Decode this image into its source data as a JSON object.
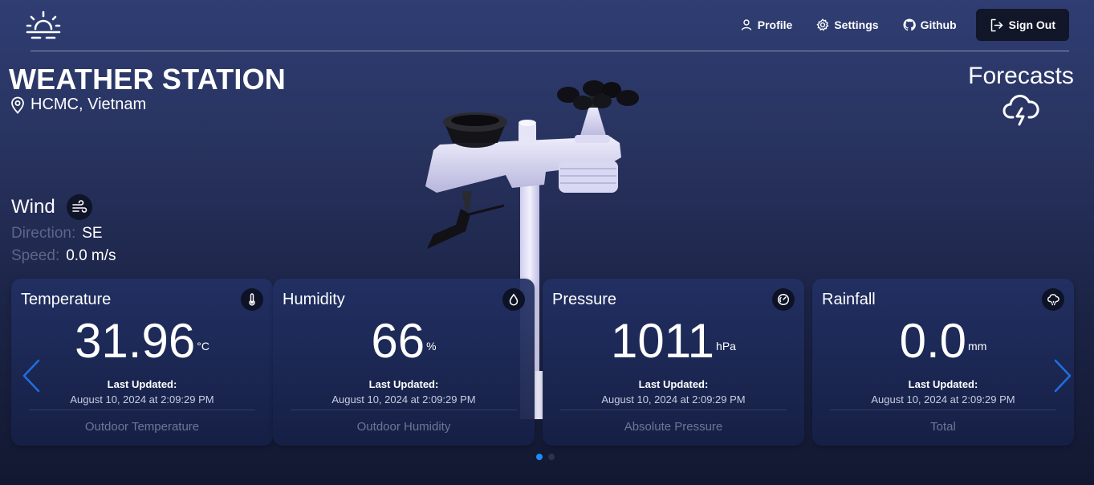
{
  "header": {
    "logo_icon": "sunrise-icon",
    "nav": [
      {
        "label": "Profile",
        "icon": "user-icon"
      },
      {
        "label": "Settings",
        "icon": "gear-icon"
      },
      {
        "label": "Github",
        "icon": "github-icon"
      }
    ],
    "sign_out": {
      "label": "Sign Out",
      "icon": "sign-out-icon"
    }
  },
  "page": {
    "title": "WEATHER STATION",
    "location": "HCMC, Vietnam",
    "forecasts_label": "Forecasts"
  },
  "wind": {
    "title": "Wind",
    "direction_label": "Direction:",
    "direction_value": "SE",
    "speed_label": "Speed:",
    "speed_value": "0.0 m/s"
  },
  "cards": [
    {
      "title": "Temperature",
      "icon": "thermometer-icon",
      "value": "31.96",
      "unit": "°C",
      "updated_label": "Last Updated:",
      "updated_time": "August 10, 2024 at 2:09:29 PM",
      "footer": "Outdoor Temperature"
    },
    {
      "title": "Humidity",
      "icon": "droplet-icon",
      "value": "66",
      "unit": "%",
      "updated_label": "Last Updated:",
      "updated_time": "August 10, 2024 at 2:09:29 PM",
      "footer": "Outdoor Humidity"
    },
    {
      "title": "Pressure",
      "icon": "gauge-icon",
      "value": "1011",
      "unit": "hPa",
      "updated_label": "Last Updated:",
      "updated_time": "August 10, 2024 at 2:09:29 PM",
      "footer": "Absolute Pressure"
    },
    {
      "title": "Rainfall",
      "icon": "rain-cloud-icon",
      "value": "0.0",
      "unit": "mm",
      "updated_label": "Last Updated:",
      "updated_time": "August 10, 2024 at 2:09:29 PM",
      "footer": "Total"
    }
  ],
  "carousel": {
    "active_page": 1,
    "pages": 2
  },
  "colors": {
    "accent": "#1a8cff",
    "arrow": "#1f6fe0",
    "muted": "#6d7699"
  }
}
